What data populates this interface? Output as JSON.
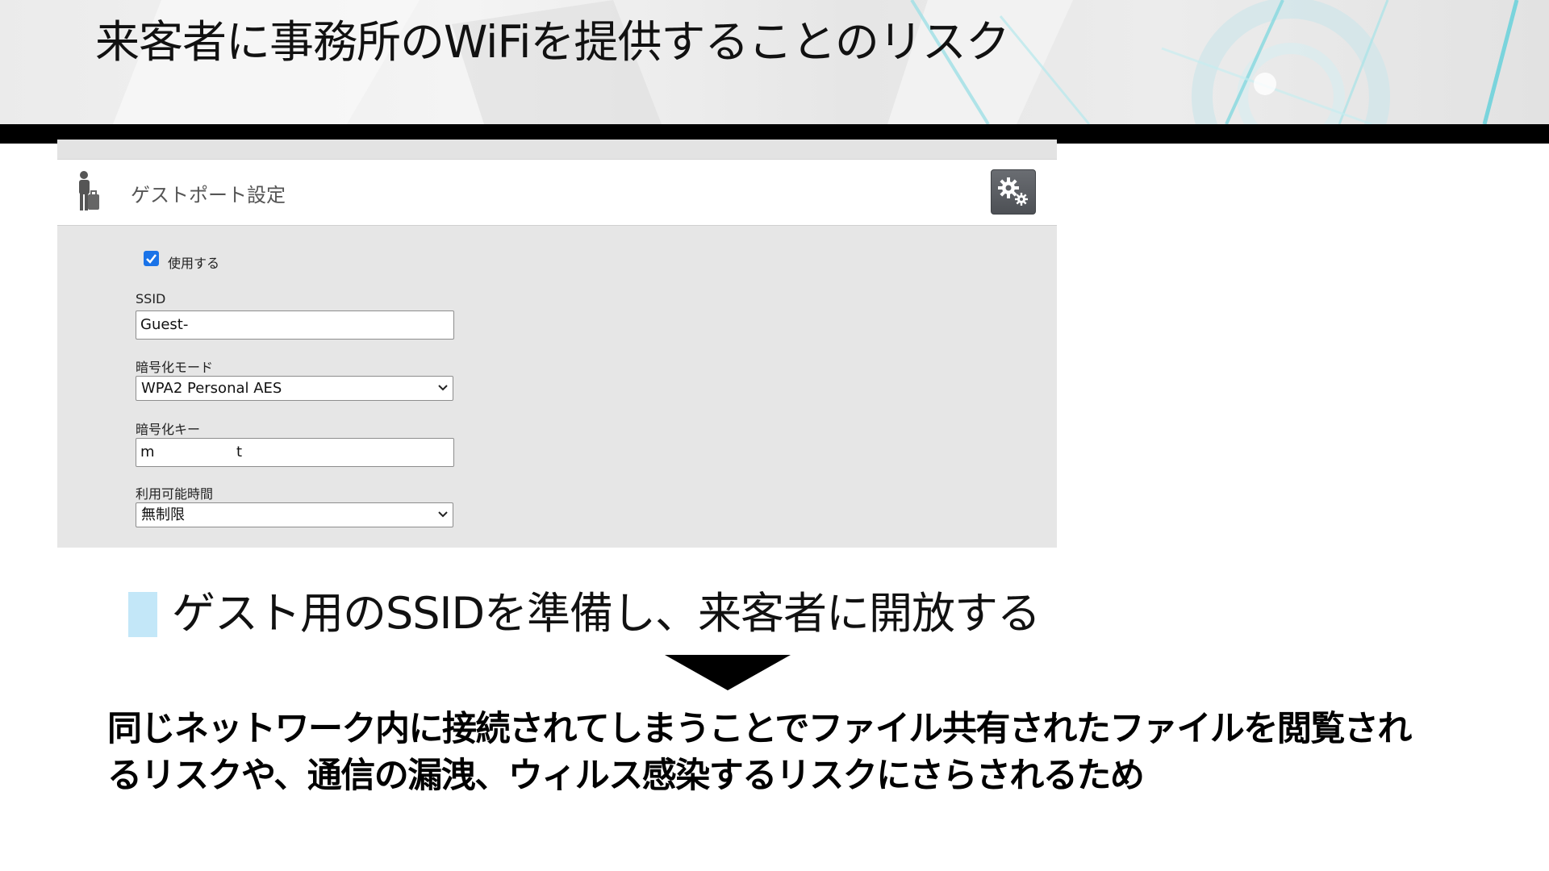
{
  "slide": {
    "title": "来客者に事務所のWiFiを提供することのリスク",
    "bullet": "ゲスト用のSSIDを準備し、来客者に開放する",
    "conclusion": "同じネットワーク内に接続されてしまうことでファイル共有されたファイルを閲覧されるリスクや、通信の漏洩、ウィルス感染するリスクにさらされるため",
    "accent_color": "#c3e7f8"
  },
  "panel": {
    "title": "ゲストポート設定",
    "header_icon": "person-with-luggage-icon",
    "settings_icon": "gears-icon",
    "enable_checkbox": {
      "label": "使用する",
      "checked": true
    },
    "ssid": {
      "label": "SSID",
      "value": "Guest-"
    },
    "encryption_mode": {
      "label": "暗号化モード",
      "selected": "WPA2 Personal AES"
    },
    "encryption_key": {
      "label": "暗号化キー",
      "value_start": "m",
      "value_end": "t"
    },
    "available_time": {
      "label": "利用可能時間",
      "selected": "無制限"
    }
  }
}
